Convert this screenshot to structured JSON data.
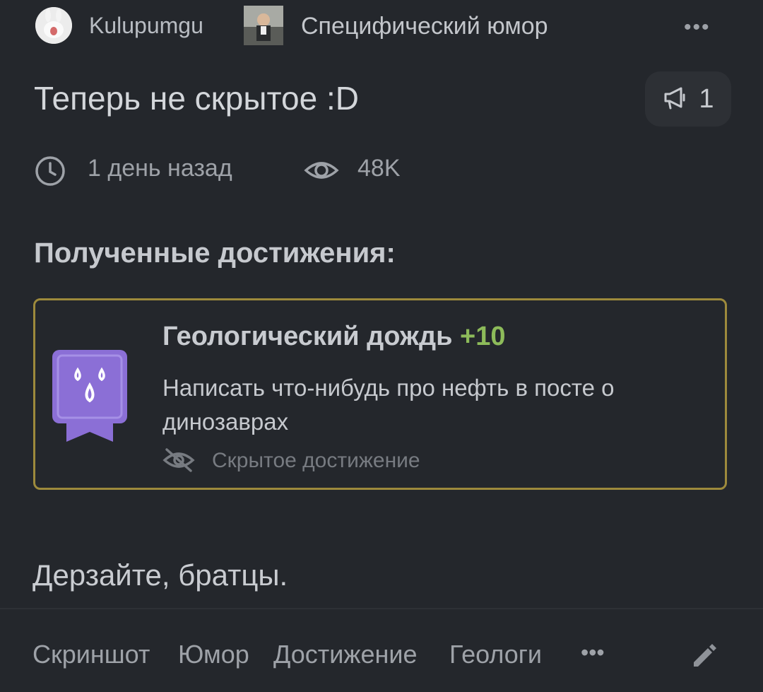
{
  "header": {
    "author": "Kulupumgu",
    "community": "Специфический юмор",
    "more_label": "•••"
  },
  "post": {
    "title": "Теперь не скрытое :D",
    "badge_count": "1",
    "time": "1 день назад",
    "views": "48K",
    "body": "Дерзайте, братцы."
  },
  "achievements": {
    "heading": "Полученные достижения:",
    "item": {
      "name": "Геологический дождь",
      "points": "+10",
      "description": "Написать что-нибудь про нефть в посте о динозаврах",
      "hidden_label": "Скрытое достижение"
    }
  },
  "tags": {
    "items": [
      "Скриншот",
      "Юмор",
      "Достижение",
      "Геологи"
    ],
    "more_label": "•••"
  },
  "colors": {
    "background": "#24272c",
    "achievement_border": "#9d8a3c",
    "medal": "#8b6fd6",
    "points": "#8dbb5a"
  },
  "icons": [
    "clock-icon",
    "eye-icon",
    "megaphone-icon",
    "drops-medal-icon",
    "eye-off-icon",
    "pencil-icon"
  ]
}
